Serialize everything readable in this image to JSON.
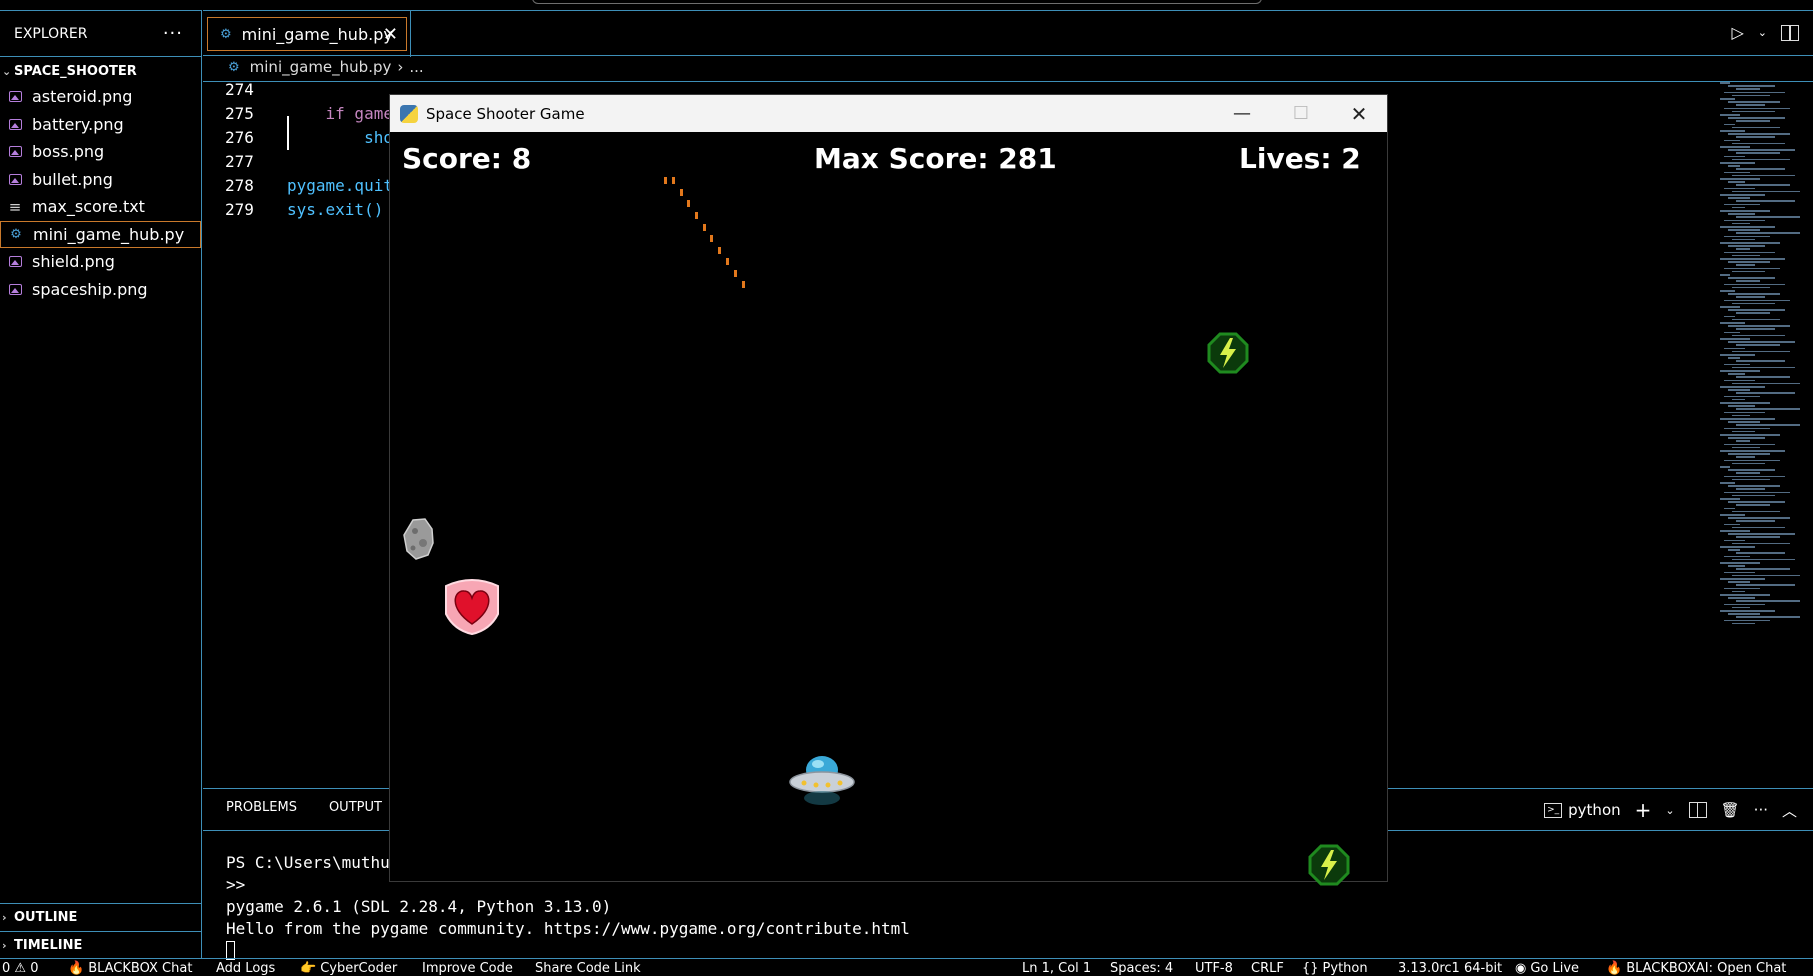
{
  "explorer": {
    "title": "EXPLORER",
    "more": "···",
    "project": "SPACE_SHOOTER",
    "files": [
      {
        "name": "asteroid.png",
        "type": "image"
      },
      {
        "name": "battery.png",
        "type": "image"
      },
      {
        "name": "boss.png",
        "type": "image"
      },
      {
        "name": "bullet.png",
        "type": "image"
      },
      {
        "name": "max_score.txt",
        "type": "text"
      },
      {
        "name": "mini_game_hub.py",
        "type": "python"
      },
      {
        "name": "shield.png",
        "type": "image"
      },
      {
        "name": "spaceship.png",
        "type": "image"
      }
    ],
    "outline": "OUTLINE",
    "timeline": "TIMELINE"
  },
  "editor": {
    "tab_label": "mini_game_hub.py",
    "tab_close": "✕",
    "breadcrumb_file": "mini_game_hub.py",
    "breadcrumb_sep": "›",
    "breadcrumb_rest": "...",
    "lines": [
      {
        "n": "274",
        "code": ""
      },
      {
        "n": "275",
        "code": "    if game"
      },
      {
        "n": "276",
        "code": "        sho"
      },
      {
        "n": "277",
        "code": ""
      },
      {
        "n": "278",
        "code": "pygame.quit"
      },
      {
        "n": "279",
        "code": "sys.exit()"
      }
    ]
  },
  "panel": {
    "tabs": [
      "PROBLEMS",
      "OUTPUT"
    ],
    "terminal_name": "python",
    "terminal_lines": [
      "PS C:\\Users\\muthu\\",
      ">>",
      "pygame 2.6.1 (SDL 2.28.4, Python 3.13.0)",
      "Hello from the pygame community. https://www.pygame.org/contribute.html"
    ]
  },
  "statusbar": {
    "problems": "0 ⚠ 0",
    "blackbox_chat": "BLACKBOX Chat",
    "add_logs": "Add Logs",
    "cybercoder": "CyberCoder",
    "improve_code": "Improve Code",
    "share_code_link": "Share Code Link",
    "position": "Ln 1, Col 1",
    "spaces": "Spaces: 4",
    "encoding": "UTF-8",
    "eol": "CRLF",
    "language": "Python",
    "interpreter": "3.13.0rc1 64-bit",
    "go_live": "Go Live",
    "blackboxai": "BLACKBOXAI: Open Chat"
  },
  "game": {
    "window_title": "Space Shooter Game",
    "score_text": "Score: 8",
    "max_score_text": "Max Score: 281",
    "lives_text": "Lives: 2",
    "sprites": [
      "asteroid",
      "shield-heart",
      "spaceship-ufo",
      "battery",
      "battery"
    ]
  },
  "colors": {
    "border_accent": "#3e8fb8",
    "active_tab_border": "#c9792b",
    "bullet": "#e2781c",
    "battery_green": "#1f8a1f",
    "shield_pink": "#f7a6b4",
    "heart_red": "#e0112b"
  }
}
